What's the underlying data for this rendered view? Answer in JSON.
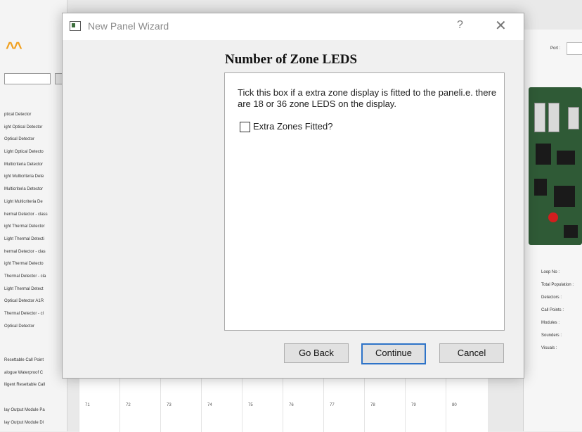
{
  "dialog": {
    "title": "New Panel Wizard",
    "help_glyph": "?",
    "close_glyph": "✕",
    "heading": "Number of Zone LEDS",
    "description": "Tick this box if a extra zone display is fitted to the paneli.e. there are 18 or 36 zone LEDS on the display.",
    "checkbox_label": "Extra Zones Fitted?",
    "checkbox_checked": false,
    "buttons": {
      "back": "Go Back",
      "continue": "Continue",
      "cancel": "Cancel"
    }
  },
  "background": {
    "left_list_1": [
      "ptical Detector",
      "ight Optical Detector",
      "Optical Detector",
      "Light Optical Detecto",
      "Multicriteria Detector",
      "ight Multicriteria Dete",
      "Multicriteria  Detector",
      "Light Multicriteria De",
      "hermal Detector - class",
      "ight Thermal Detector",
      "Light Thermal Detecti",
      "hermal Detector - clas",
      "ight Thermal Detecto",
      "Thermal Detector - cla",
      "Light Thermal Detect",
      "Optical Detector A1R",
      "Thermal Detector - cl",
      "Optical Detector"
    ],
    "left_list_2": [
      "Resettable Call Point",
      "alogue Waterproof C",
      "lligent Resettable Call"
    ],
    "left_list_3": [
      "lay Output Module Pa",
      "lay Output Module Dl"
    ],
    "grid_numbers": [
      "71",
      "72",
      "73",
      "74",
      "75",
      "76",
      "77",
      "78",
      "79",
      "80"
    ],
    "right_panel": {
      "port_label": "Port :",
      "stats": [
        "Loop No :",
        "Total Population :",
        "Detectors :",
        "Call Points :",
        "Modules :",
        "Sounders :",
        "Visuals :"
      ]
    }
  }
}
